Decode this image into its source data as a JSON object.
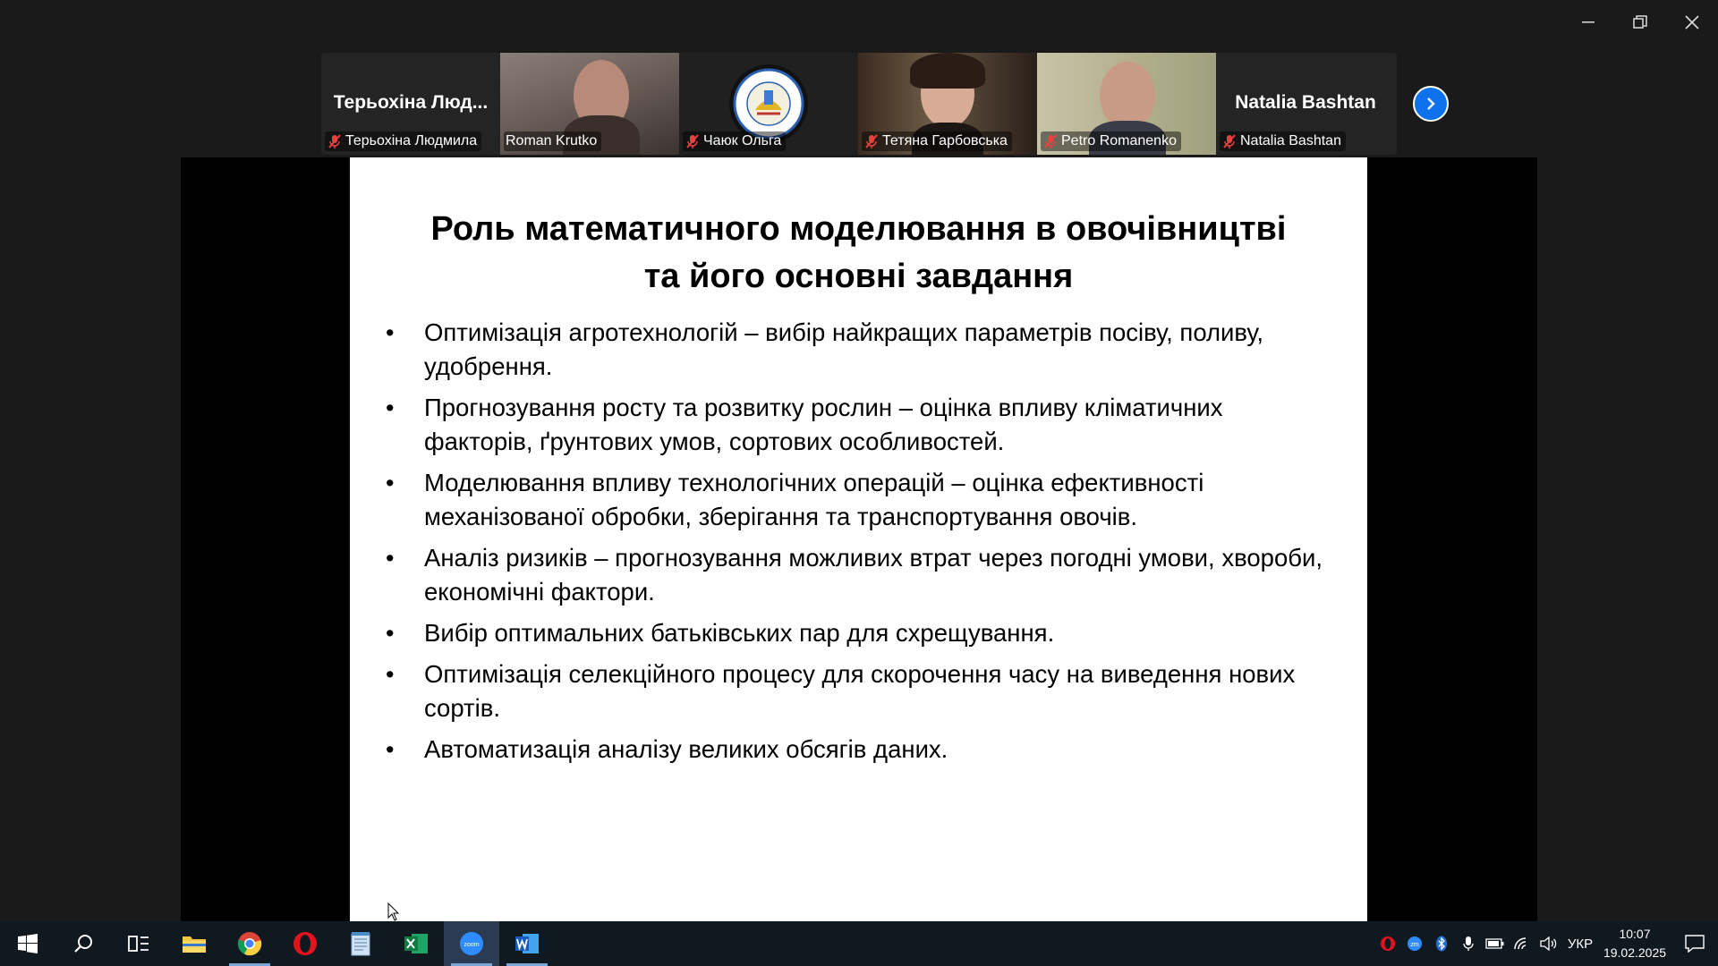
{
  "participants": [
    {
      "big_name": "Терьохіна Люд...",
      "label": "Терьохіна Людмила",
      "muted": true,
      "video": false
    },
    {
      "big_name": "",
      "label": "Roman Krutko",
      "muted": false,
      "video": true,
      "active_speaker": true
    },
    {
      "big_name": "",
      "label": "Чаюк Ольга",
      "muted": true,
      "video": false,
      "avatar": "university-logo"
    },
    {
      "big_name": "",
      "label": "Тетяна Гарбовська",
      "muted": true,
      "video": true
    },
    {
      "big_name": "",
      "label": "Petro Romanenko",
      "muted": true,
      "video": true
    },
    {
      "big_name": "Natalia Bashtan",
      "label": "Natalia Bashtan",
      "muted": true,
      "video": false
    }
  ],
  "slide": {
    "title_line1": "Роль математичного моделювання в овочівництві",
    "title_line2": "та його основні завдання",
    "bullets": [
      "Оптимізація агротехнологій – вибір найкращих параметрів посіву, поливу, удобрення.",
      "Прогнозування росту та розвитку рослин – оцінка впливу кліматичних факторів, ґрунтових умов, сортових особливостей.",
      "Моделювання впливу технологічних операцій – оцінка ефективності механізованої обробки, зберігання та транспортування овочів.",
      "Аналіз ризиків – прогнозування можливих втрат через погодні умови, хвороби, економічні фактори.",
      "Вибір оптимальних батьківських пар для схрещування.",
      "Оптимізація селекційного процесу для скорочення часу на виведення нових сортів.",
      "Автоматизація аналізу великих обсягів даних."
    ]
  },
  "taskbar": {
    "apps": [
      "start",
      "search",
      "task-view",
      "file-explorer",
      "chrome",
      "opera",
      "notepad",
      "excel",
      "zoom",
      "word"
    ],
    "language": "УКР",
    "time": "10:07",
    "date": "19.02.2025"
  },
  "colors": {
    "active_speaker_border": "#23d96f",
    "next_button": "#0e72ed",
    "mute_red": "#e8413f",
    "taskbar": "#101820"
  }
}
